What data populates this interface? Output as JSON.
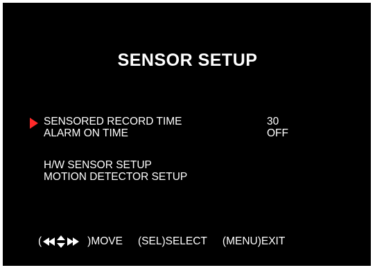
{
  "menu": {
    "title": "SENSOR SETUP",
    "items": [
      {
        "label": "SENSORED RECORD TIME",
        "value": "30",
        "selected": true
      },
      {
        "label": "ALARM ON TIME",
        "value": "OFF",
        "selected": false
      },
      {
        "label": "H/W SENSOR SETUP",
        "value": "",
        "selected": false
      },
      {
        "label": "MOTION DETECTOR SETUP",
        "value": "",
        "selected": false
      }
    ]
  },
  "footer": {
    "open_paren": "(",
    "move_label": ")MOVE",
    "select_label": "(SEL)SELECT",
    "exit_label": "(MENU)EXIT"
  },
  "colors": {
    "background": "#000000",
    "text": "#ffffff",
    "cursor": "#ff2a2a"
  },
  "icons": {
    "cursor": "red-triangle-cursor-icon",
    "navigation": "arrow-keys-icon"
  }
}
